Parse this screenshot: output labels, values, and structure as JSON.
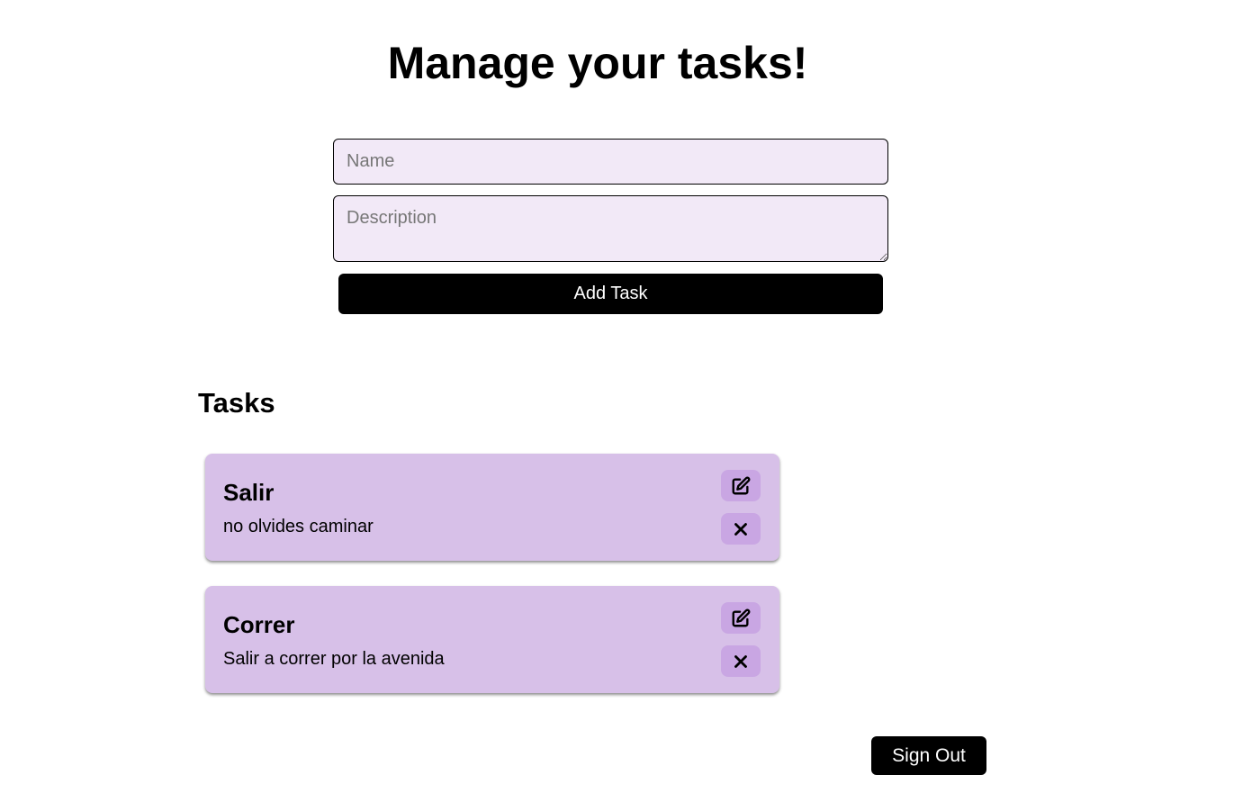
{
  "header": {
    "title": "Manage your tasks!"
  },
  "form": {
    "name_placeholder": "Name",
    "name_value": "",
    "description_placeholder": "Description",
    "description_value": "",
    "add_button_label": "Add Task"
  },
  "tasks": {
    "heading": "Tasks",
    "items": [
      {
        "title": "Salir",
        "description": "no olvides caminar",
        "edit_icon": "edit-icon",
        "delete_icon": "close-icon"
      },
      {
        "title": "Correr",
        "description": "Salir a correr por la avenida",
        "edit_icon": "edit-icon",
        "delete_icon": "close-icon"
      }
    ]
  },
  "footer": {
    "sign_out_label": "Sign Out"
  },
  "colors": {
    "input_background": "#f2e9f7",
    "card_background": "#d7c0e8",
    "icon_button_background": "#c9a6e3",
    "primary_button": "#000000"
  }
}
